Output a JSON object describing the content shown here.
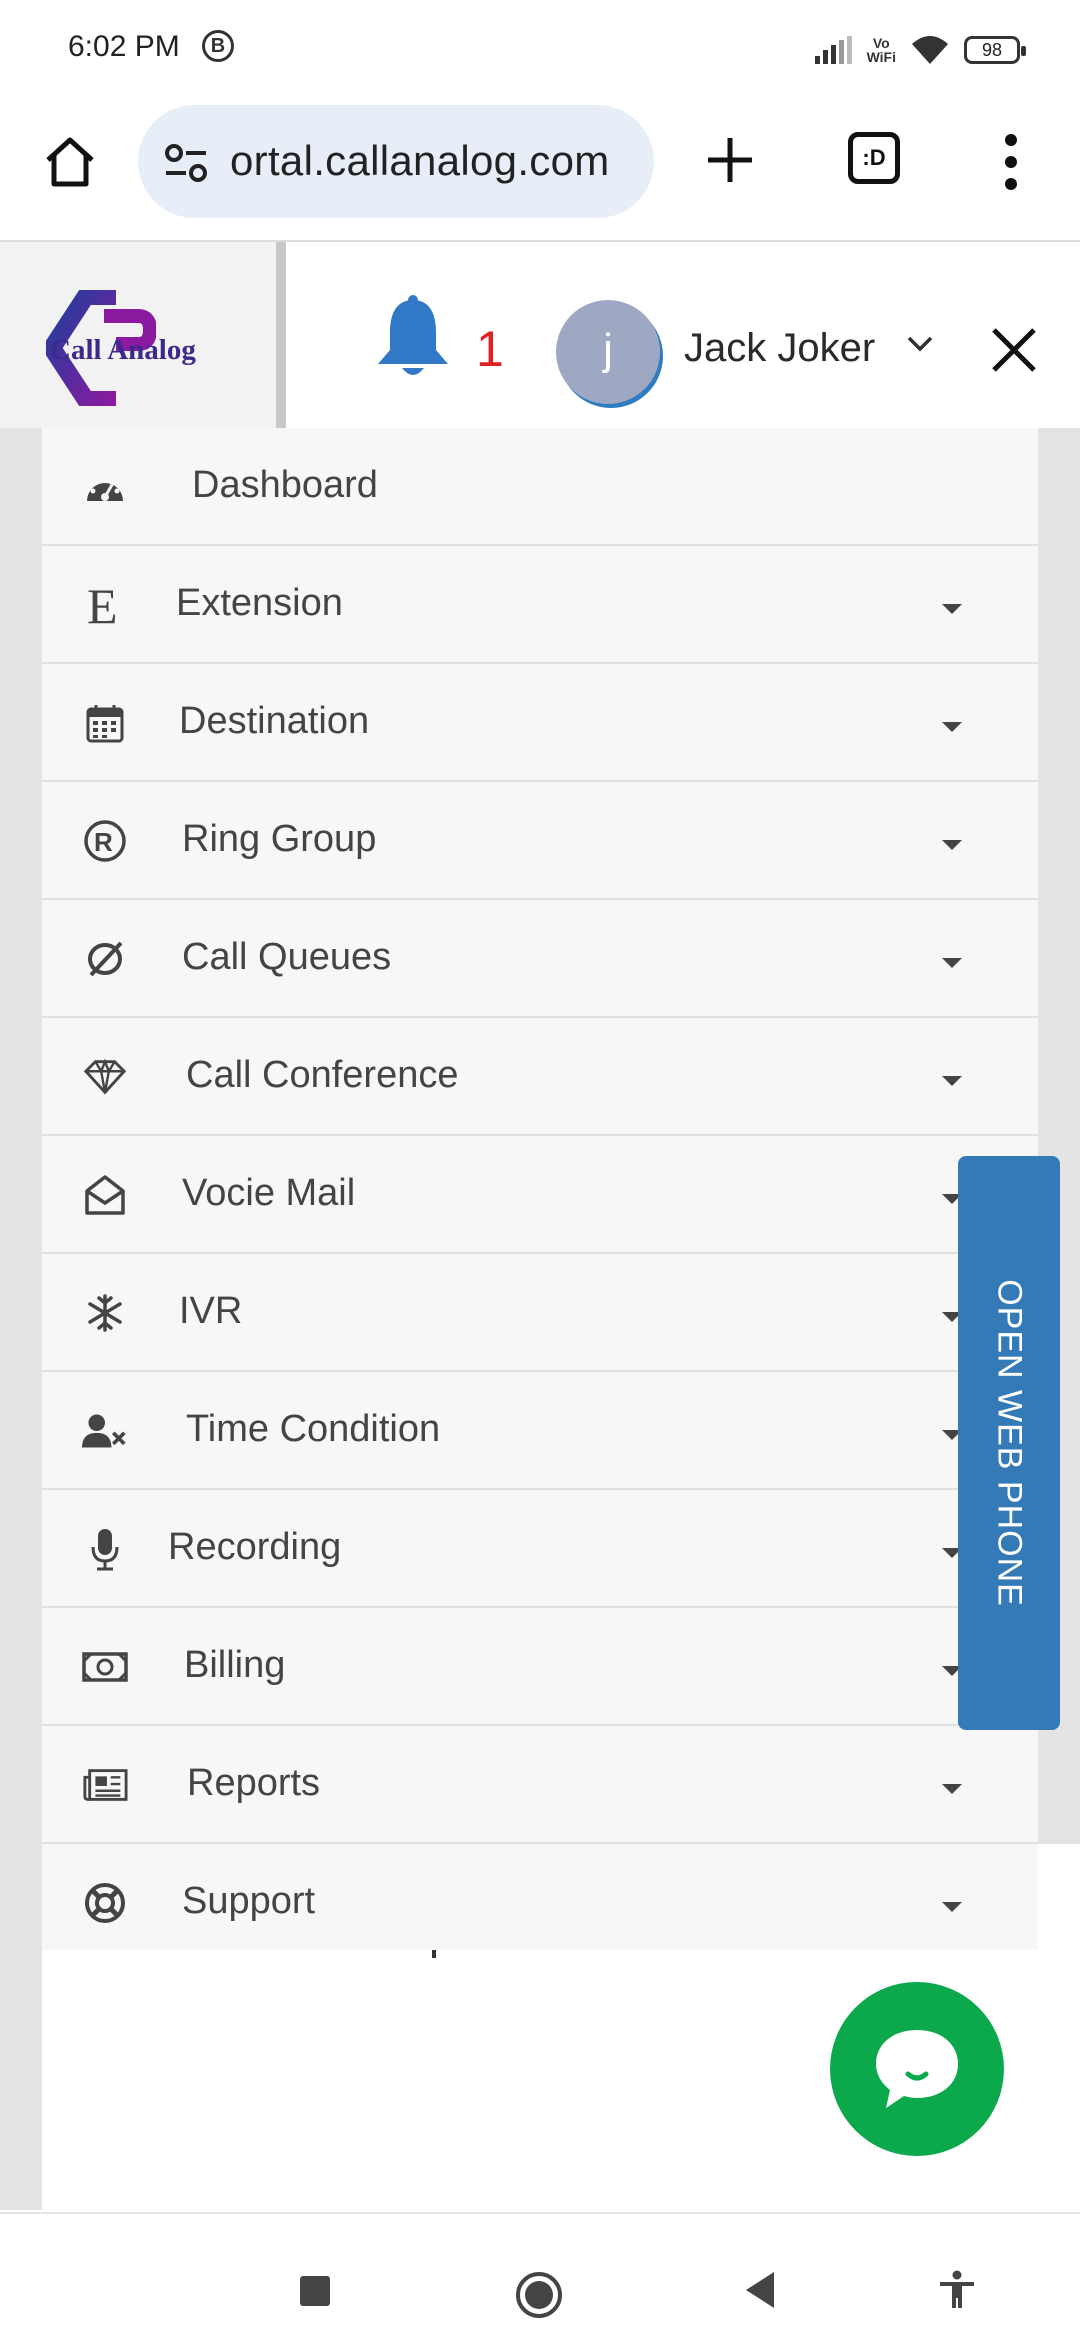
{
  "status_bar": {
    "time": "6:02 PM",
    "b_badge": "B",
    "vowifi_line1": "Vo",
    "vowifi_line2": "WiFi",
    "battery": "98"
  },
  "browser": {
    "url": "ortal.callanalog.com",
    "tabs_label": ":D"
  },
  "header": {
    "logo_text": "Call Analog",
    "notification_count": "1",
    "avatar_initial": "j",
    "user_name": "Jack Joker"
  },
  "menu": {
    "items": [
      {
        "label": "Dashboard",
        "icon": "tachometer-icon",
        "has_caret": false
      },
      {
        "label": "Extension",
        "icon": "letter-e-icon",
        "has_caret": true
      },
      {
        "label": "Destination",
        "icon": "calendar-icon",
        "has_caret": true
      },
      {
        "label": "Ring Group",
        "icon": "registered-icon",
        "has_caret": true
      },
      {
        "label": "Call Queues",
        "icon": "queue-loop-icon",
        "has_caret": true
      },
      {
        "label": "Call Conference",
        "icon": "diamond-icon",
        "has_caret": true
      },
      {
        "label": "Vocie Mail",
        "icon": "envelope-open-icon",
        "has_caret": true
      },
      {
        "label": "IVR",
        "icon": "snowflake-icon",
        "has_caret": true
      },
      {
        "label": "Time Condition",
        "icon": "user-times-icon",
        "has_caret": true
      },
      {
        "label": "Recording",
        "icon": "microphone-icon",
        "has_caret": true
      },
      {
        "label": "Billing",
        "icon": "money-bill-icon",
        "has_caret": true
      },
      {
        "label": "Reports",
        "icon": "newspaper-icon",
        "has_caret": true
      },
      {
        "label": "Support",
        "icon": "life-ring-icon",
        "has_caret": true
      }
    ]
  },
  "web_phone_label": "OPEN WEB PHONE",
  "colors": {
    "accent_blue": "#337ab7",
    "chat_green": "#0ba94b",
    "notification_red": "#e02020",
    "logo_purple": "#6a1b9a"
  }
}
